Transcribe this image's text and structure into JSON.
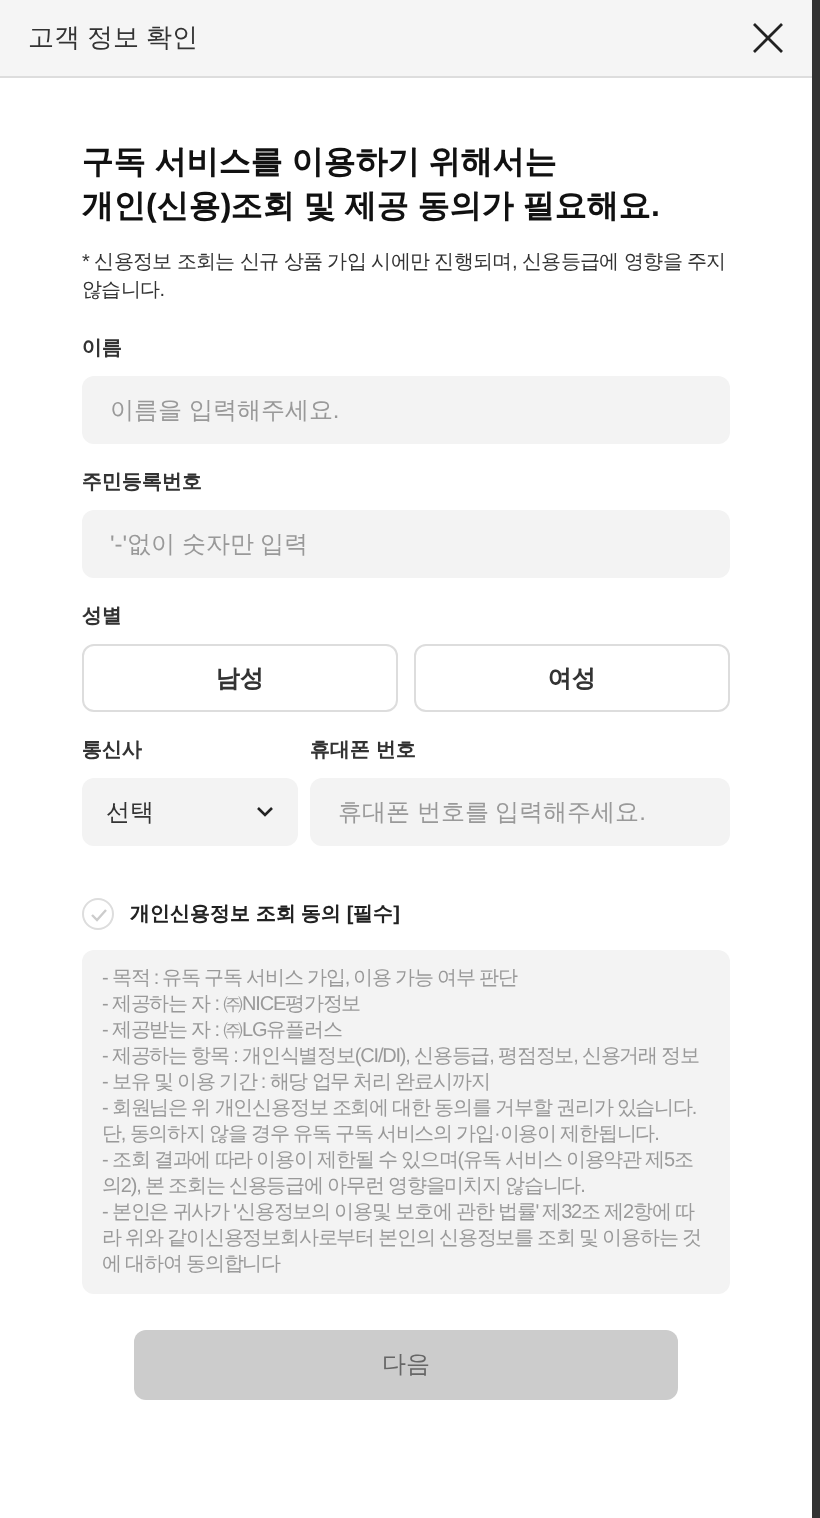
{
  "window": {
    "title": "고객 정보 확인"
  },
  "heading": {
    "lines": [
      "구독 서비스를 이용하기 위해서는",
      "개인(신용)조회 및 제공 동의가 필요해요."
    ]
  },
  "note": "* 신용정보 조회는 신규 상품 가입 시에만 진행되며, 신용등급에 영향을 주지 않습니다.",
  "fields": [
    {
      "kind": "text",
      "label": "이름",
      "placeholder": "이름을 입력해주세요."
    },
    {
      "kind": "text",
      "label": "주민등록번호",
      "placeholder": "'-'없이 숫자만 입력"
    },
    {
      "kind": "choice",
      "label": "성별",
      "options": [
        {
          "label": "남성",
          "selected": false
        },
        {
          "label": "여성",
          "selected": false
        }
      ]
    },
    {
      "kind": "phone",
      "carrier": {
        "label": "통신사",
        "value": "선택"
      },
      "phone": {
        "label": "휴대폰 번호",
        "placeholder": "휴대폰 번호를 입력해주세요."
      }
    }
  ],
  "consent": {
    "label": "개인신용정보 조회 동의 [필수]",
    "checked": false
  },
  "terms": [
    "- 목적 : 유독 구독 서비스 가입, 이용 가능 여부 판단",
    "- 제공하는 자 : ㈜NICE평가정보",
    "- 제공받는 자 : ㈜LG유플러스",
    "- 제공하는 항목 : 개인식별정보(CI/DI), 신용등급, 평점정보, 신용거래 정보",
    "- 보유 및 이용 기간 : 해당 업무 처리 완료시까지",
    "- 회원님은 위 개인신용정보 조회에 대한 동의를 거부할 권리가 있습니다.단, 동의하지 않을 경우 유독 구독 서비스의 가입·이용이 제한됩니다.",
    "- 조회 결과에 따라 이용이 제한될 수 있으며(유독 서비스 이용약관 제5조의2), 본 조회는 신용등급에 아무런 영향을미치지 않습니다.",
    "- 본인은 귀사가 '신용정보의 이용및 보호에 관한 법률' 제32조 제2항에 따라 위와 같이신용정보회사로부터 본인의 신용정보를 조회 및 이용하는 것에 대하여 동의합니다"
  ],
  "next_button": {
    "label": "다음",
    "disabled": true
  }
}
